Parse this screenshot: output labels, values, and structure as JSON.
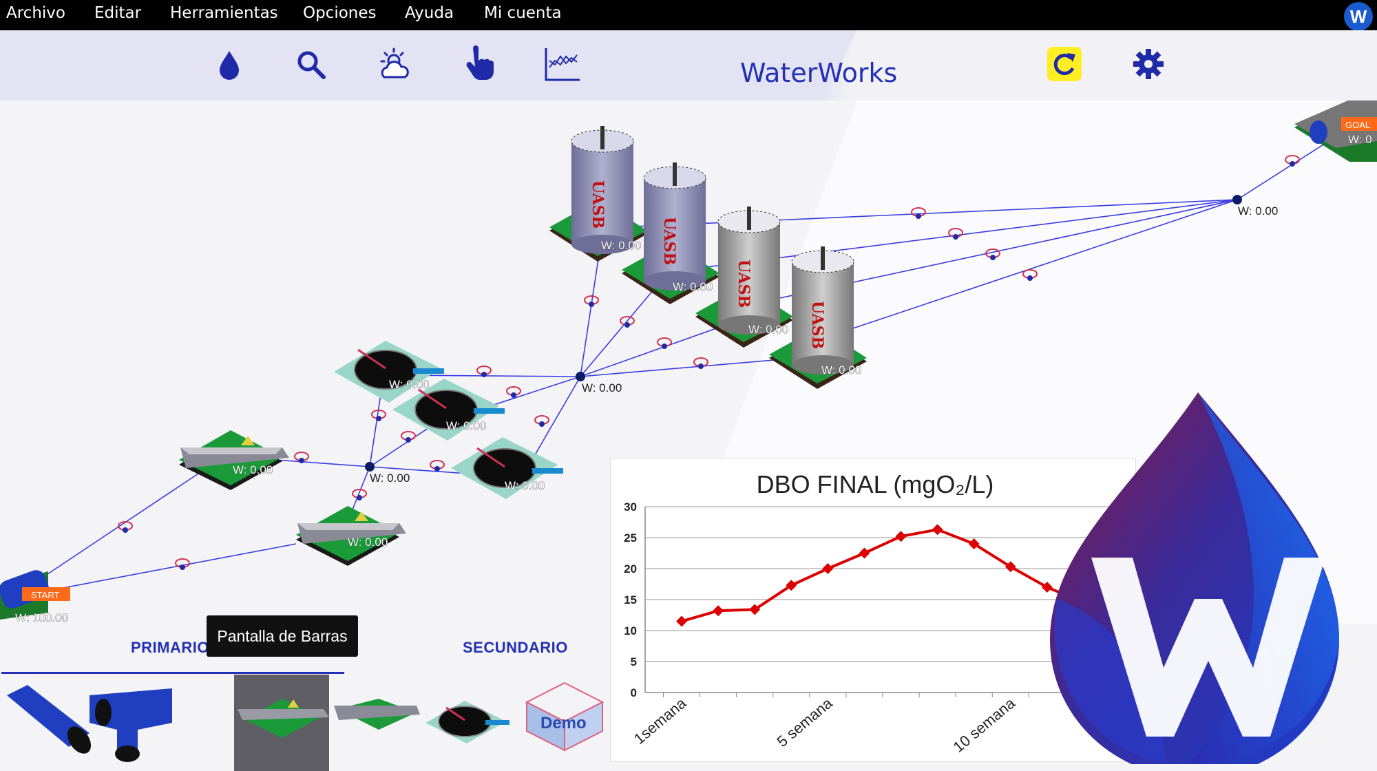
{
  "menu": {
    "items": [
      "Archivo",
      "Editar",
      "Herramientas",
      "Opciones",
      "Ayuda",
      "Mi cuenta"
    ],
    "brand_badge": "W"
  },
  "toolbar": {
    "title": "WaterWorks",
    "icons": [
      "water-drop-icon",
      "search-icon",
      "weather-icon",
      "pointer-hand-icon",
      "chart-icon",
      "refresh-icon",
      "settings-icon"
    ],
    "accent_color": "#2330b6",
    "refresh_bg": "#ffee22"
  },
  "diagram": {
    "start_label": "START",
    "start_value": "W: 100.00",
    "goal_label": "GOAL",
    "goal_value": "W: 0",
    "uasb_letters": "UASB",
    "uasb_labels": [
      "W: 0.00",
      "W: 0.00",
      "W: 0.00",
      "W: 0.00"
    ],
    "junction_labels": [
      "W: 0.00",
      "W: 0.00",
      "W: 0.00"
    ],
    "clarifier_labels": [
      "W: 0.00",
      "W: 0.00",
      "W: 0.00"
    ],
    "screen_labels": [
      "W: 0.00",
      "W: 0.00"
    ],
    "line_color": "#3b3be0",
    "tank_color": "#8c8cb6"
  },
  "bottom_panel": {
    "tabs": [
      {
        "label": "PRIMARIO"
      },
      {
        "label": "SECUNDARIO"
      }
    ],
    "tooltip": "Pantalla de Barras",
    "palette_items": [
      "straight-pipe",
      "y-pipe",
      "bar-screen",
      "grit-channel",
      "clarifier",
      "demo-module"
    ],
    "demo_label": "Demo"
  },
  "chart_data": {
    "type": "line",
    "title": "DBO FINAL (mgO₂/L)",
    "x": [
      1,
      2,
      3,
      4,
      5,
      6,
      7,
      8,
      9,
      10,
      11,
      12
    ],
    "x_tick_labels": [
      {
        "x": 1,
        "label": "1semana"
      },
      {
        "x": 5,
        "label": "5 semana"
      },
      {
        "x": 10,
        "label": "10 semana"
      }
    ],
    "series": [
      {
        "values": [
          11.5,
          13.2,
          13.4,
          17.3,
          20.0,
          22.5,
          25.2,
          26.3,
          24.0,
          20.3,
          17.0,
          14.5
        ],
        "color": "#dd0000"
      }
    ],
    "ylim": [
      0,
      30
    ],
    "y_ticks": [
      0,
      5,
      10,
      15,
      20,
      25,
      30
    ],
    "grid": true,
    "legend": "none"
  },
  "logo": {
    "letter": "W"
  }
}
